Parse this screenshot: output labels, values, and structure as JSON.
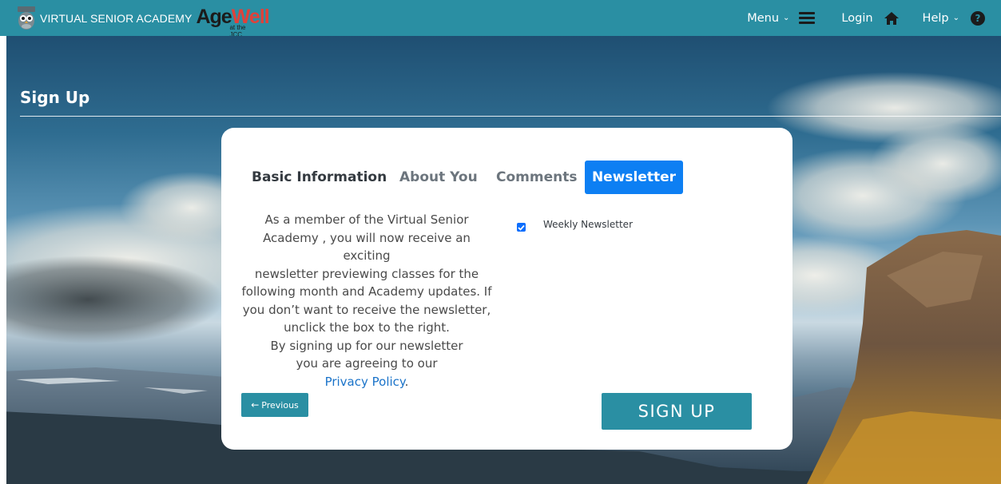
{
  "header": {
    "brand": "VIRTUAL SENIOR ACADEMY",
    "logo_age": "Age",
    "logo_well": "Well",
    "logo_sub": "at the JCC",
    "menu_label": "Menu",
    "login_label": "Login",
    "help_label": "Help",
    "help_glyph": "?"
  },
  "page": {
    "title": "Sign Up"
  },
  "tabs": [
    {
      "label": "Basic Information"
    },
    {
      "label": "About You"
    },
    {
      "label": "Comments"
    },
    {
      "label": "Newsletter",
      "active": true
    }
  ],
  "newsletter": {
    "description_lines": [
      "As a member of the Virtual Senior",
      "Academy , you will now receive an exciting",
      "newsletter previewing classes for the",
      "following month and Academy updates. If",
      "you don’t want to receive the newsletter,",
      "unclick the box to the right.",
      "By signing up for our newsletter",
      "you are agreeing to our"
    ],
    "privacy_link": "Privacy Policy",
    "privacy_suffix": ".",
    "checkbox_label": "Weekly Newsletter",
    "checkbox_checked": true
  },
  "buttons": {
    "previous": "Previous",
    "signup": "SIGN UP"
  },
  "colors": {
    "header_bg": "#2a8fa3",
    "active_tab": "#0d7ff3",
    "button_bg": "#2a8fa3",
    "link": "#1a73c9",
    "logo_well": "#e0413a"
  },
  "icons": {
    "brand": "owl-logo-icon",
    "menu": "hamburger-icon",
    "login": "home-icon",
    "help": "help-circle-icon",
    "previous": "arrow-left-icon",
    "check": "check-icon"
  }
}
